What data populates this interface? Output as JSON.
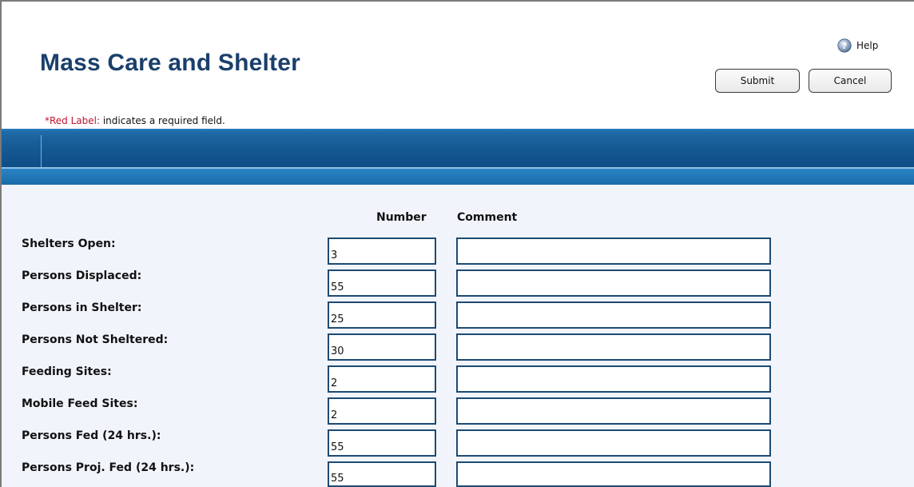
{
  "header": {
    "title": "Mass Care and Shelter",
    "help_label": "Help",
    "submit_label": "Submit",
    "cancel_label": "Cancel"
  },
  "required_note": {
    "red_part": "*Red Label:",
    "rest": " indicates a required field."
  },
  "table": {
    "columns": [
      "Number",
      "Comment"
    ],
    "rows": [
      {
        "label": "Shelters Open:",
        "number": "3",
        "comment": ""
      },
      {
        "label": "Persons Displaced:",
        "number": "55",
        "comment": ""
      },
      {
        "label": "Persons in Shelter:",
        "number": "25",
        "comment": ""
      },
      {
        "label": "Persons Not Sheltered:",
        "number": "30",
        "comment": ""
      },
      {
        "label": "Feeding Sites:",
        "number": "2",
        "comment": ""
      },
      {
        "label": "Mobile Feed Sites:",
        "number": "2",
        "comment": ""
      },
      {
        "label": "Persons Fed (24 hrs.):",
        "number": "55",
        "comment": ""
      },
      {
        "label": "Persons Proj. Fed (24 hrs.):",
        "number": "55",
        "comment": ""
      }
    ]
  },
  "colors": {
    "title": "#1a3f6b",
    "required": "#c0142c",
    "bar": "#165b95",
    "field_border": "#1e4a72"
  }
}
